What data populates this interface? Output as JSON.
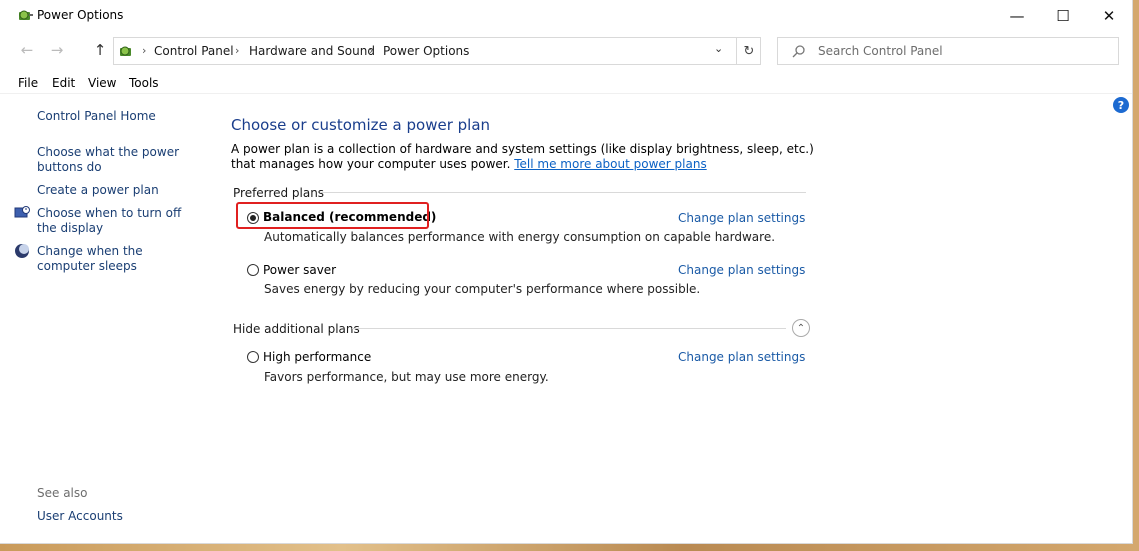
{
  "window": {
    "title": "Power Options"
  },
  "nav": {
    "back": "←",
    "forward": "→",
    "up": "↑"
  },
  "breadcrumb": [
    "Control Panel",
    "Hardware and Sound",
    "Power Options"
  ],
  "search": {
    "placeholder": "Search Control Panel"
  },
  "menu": [
    "File",
    "Edit",
    "View",
    "Tools"
  ],
  "sidebar": {
    "home": "Control Panel Home",
    "links": [
      "Choose what the power buttons do",
      "Create a power plan",
      "Choose when to turn off the display",
      "Change when the computer sleeps"
    ],
    "see_also_label": "See also",
    "see_also": [
      "User Accounts"
    ]
  },
  "main": {
    "title": "Choose or customize a power plan",
    "description": "A power plan is a collection of hardware and system settings (like display brightness, sleep, etc.) that manages how your computer uses power.",
    "learn_more": "Tell me more about power plans",
    "preferred_label": "Preferred plans",
    "additional_label": "Hide additional plans",
    "change_link": "Change plan settings",
    "plans": [
      {
        "name": "Balanced (recommended)",
        "desc": "Automatically balances performance with energy consumption on capable hardware.",
        "selected": true
      },
      {
        "name": "Power saver",
        "desc": "Saves energy by reducing your computer's performance where possible.",
        "selected": false
      },
      {
        "name": "High performance",
        "desc": "Favors performance, but may use more energy.",
        "selected": false
      }
    ]
  },
  "help": "?",
  "colors": {
    "link": "#1a5aa6",
    "title": "#1a3e8c",
    "highlight": "#e02020"
  }
}
